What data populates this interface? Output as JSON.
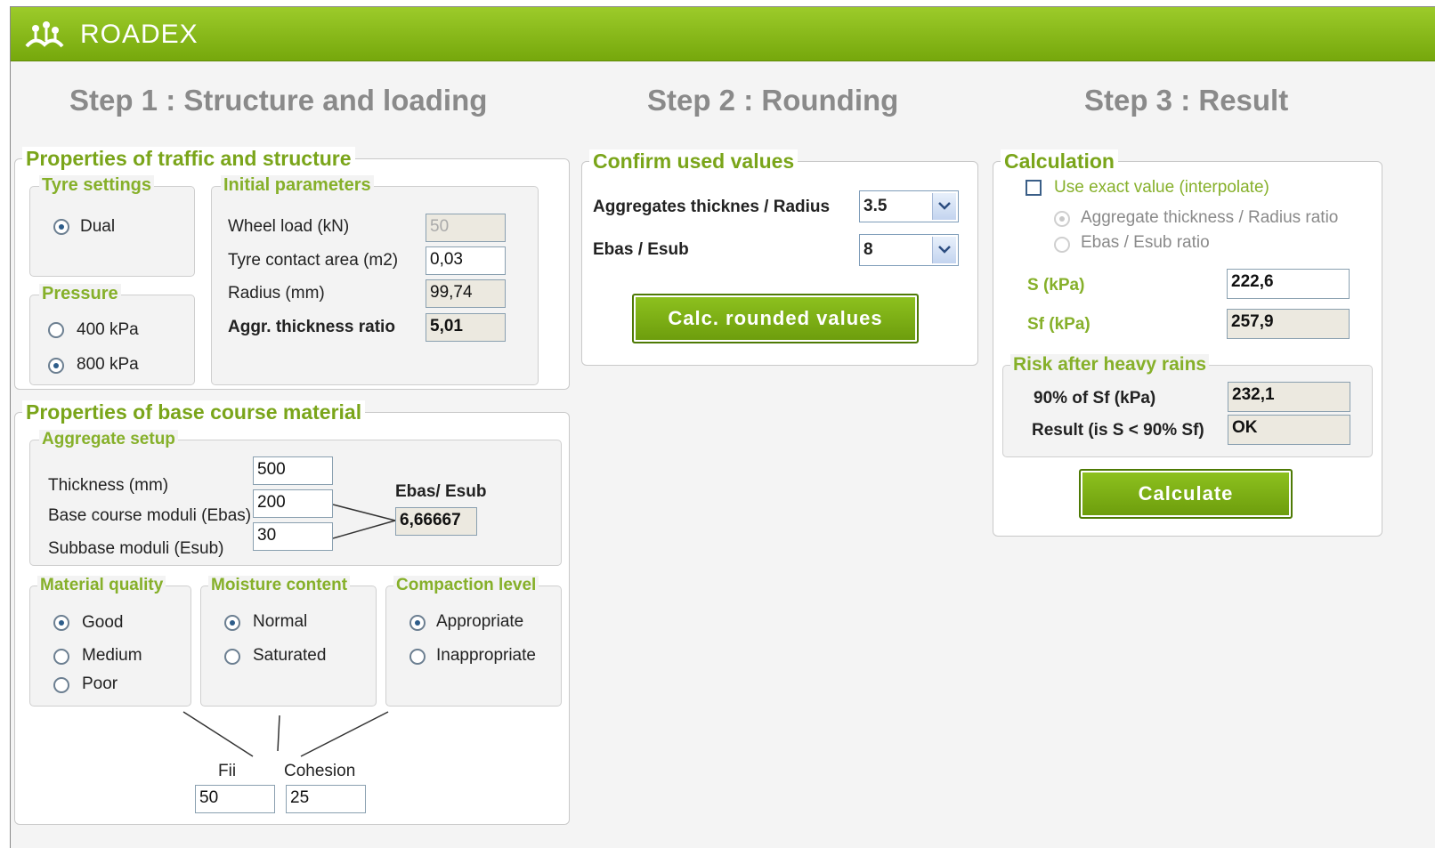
{
  "app": {
    "brand": "ROADEX"
  },
  "steps": [
    "Step 1 : Structure and loading",
    "Step 2 : Rounding",
    "Step 3 : Result"
  ],
  "traffic": {
    "title": "Properties of traffic and structure",
    "tyre": {
      "title": "Tyre settings",
      "option": "Dual"
    },
    "pressure": {
      "title": "Pressure",
      "options": [
        "400 kPa",
        "800 kPa"
      ],
      "selected": "800 kPa"
    },
    "initial": {
      "title": "Initial parameters",
      "wheel_load_label": "Wheel load (kN)",
      "wheel_load": "50",
      "contact_label": "Tyre contact area (m2)",
      "contact": "0,03",
      "radius_label": "Radius (mm)",
      "radius": "99,74",
      "ratio_label": "Aggr. thickness ratio",
      "ratio": "5,01"
    }
  },
  "base": {
    "title": "Properties of base course material",
    "aggregate": {
      "title": "Aggregate setup",
      "thickness_label": "Thickness (mm)",
      "thickness": "500",
      "base_label": "Base course moduli (Ebas)",
      "base": "200",
      "subbase_label": "Subbase moduli (Esub)",
      "subbase": "30",
      "ratio_label": "Ebas/ Esub",
      "ratio": "6,66667"
    },
    "quality": {
      "title": "Material quality",
      "options": [
        "Good",
        "Medium",
        "Poor"
      ],
      "selected": "Good"
    },
    "moisture": {
      "title": "Moisture content",
      "options": [
        "Normal",
        "Saturated"
      ],
      "selected": "Normal"
    },
    "compaction": {
      "title": "Compaction level",
      "options": [
        "Appropriate",
        "Inappropriate"
      ],
      "selected": "Appropriate"
    },
    "fii_label": "Fii",
    "fii": "50",
    "cohesion_label": "Cohesion",
    "cohesion": "25"
  },
  "confirm": {
    "title": "Confirm used values",
    "agg_label": "Aggregates thicknes / Radius",
    "agg_value": "3.5",
    "ebas_label": "Ebas / Esub",
    "ebas_value": "8",
    "button": "Calc. rounded values"
  },
  "calculation": {
    "title": "Calculation",
    "exact_label": "Use exact value (interpolate)",
    "exact_checked": false,
    "options": [
      "Aggregate thickness / Radius ratio",
      "Ebas / Esub ratio"
    ],
    "s_label": "S (kPa)",
    "s": "222,6",
    "sf_label": "Sf (kPa)",
    "sf": "257,9",
    "risk": {
      "title": "Risk after heavy rains",
      "p90_label": "90% of Sf (kPa)",
      "p90": "232,1",
      "result_label": "Result (is S < 90% Sf)",
      "result": "OK"
    },
    "button": "Calculate"
  },
  "colors": {
    "accent": "#7aa51a",
    "header": "#86b818"
  }
}
